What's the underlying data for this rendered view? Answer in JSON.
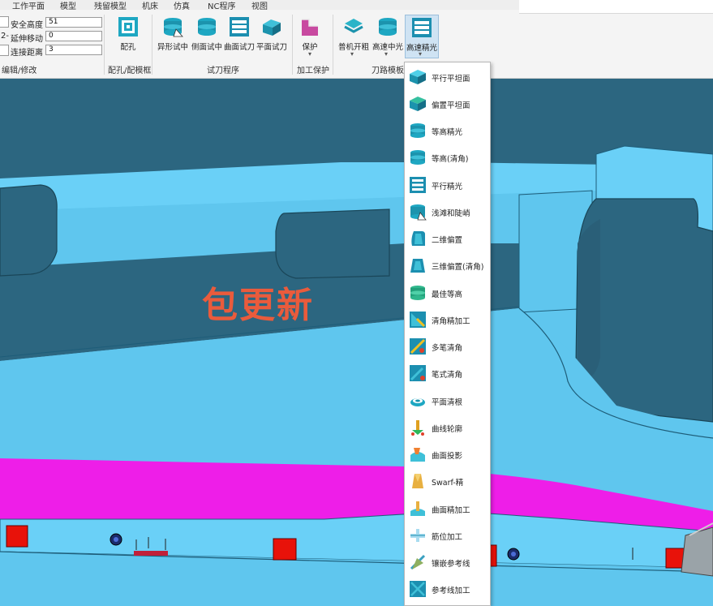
{
  "menu": [
    "工作平面",
    "模型",
    "残留模型",
    "机床",
    "仿真",
    "NC程序",
    "视图"
  ],
  "params": {
    "side_text": "2-",
    "safe_height_label": "安全高度",
    "safe_height_value": "51",
    "extend_move_label": "延伸移动",
    "extend_move_value": "0",
    "connect_dist_label": "连接距离",
    "connect_dist_value": "3"
  },
  "groups": {
    "edit": "编辑/修改",
    "hole": "配孔/配模框",
    "test": "试刀程序",
    "protect": "加工保护",
    "template": "刀路模板"
  },
  "buttons": {
    "hole": "配孔",
    "irregular": "异形试中",
    "side": "侧面试中",
    "surface": "曲面试刀",
    "plane": "平面试刀",
    "protect": "保护",
    "rough": "普机开粗",
    "hs_mid": "高速中光",
    "hs_finish": "高速精光",
    "dropdown_arrow": "▾"
  },
  "dropdown": [
    {
      "label": "平行平坦面",
      "icon": "parallel-flat-icon"
    },
    {
      "label": "偏置平坦面",
      "icon": "offset-flat-icon"
    },
    {
      "label": "等高精光",
      "icon": "constant-z-icon"
    },
    {
      "label": "等高(清角)",
      "icon": "constant-z-corner-icon"
    },
    {
      "label": "平行精光",
      "icon": "parallel-finish-icon"
    },
    {
      "label": "浅滩和陡峭",
      "icon": "shallow-steep-icon"
    },
    {
      "label": "二维偏置",
      "icon": "2d-offset-icon"
    },
    {
      "label": "三维偏置(清角)",
      "icon": "3d-offset-icon"
    },
    {
      "label": "最佳等高",
      "icon": "optimized-z-icon"
    },
    {
      "label": "清角精加工",
      "icon": "corner-finish-icon"
    },
    {
      "label": "多笔清角",
      "icon": "multi-pencil-icon"
    },
    {
      "label": "笔式清角",
      "icon": "pencil-corner-icon"
    },
    {
      "label": "平面清根",
      "icon": "flat-rest-icon"
    },
    {
      "label": "曲线轮廓",
      "icon": "curve-profile-icon"
    },
    {
      "label": "曲面投影",
      "icon": "surface-projection-icon"
    },
    {
      "label": "Swarf-精",
      "icon": "swarf-icon"
    },
    {
      "label": "曲面精加工",
      "icon": "surface-finish-icon"
    },
    {
      "label": "筋位加工",
      "icon": "rib-icon"
    },
    {
      "label": "镶嵌参考线",
      "icon": "embedded-ref-icon"
    },
    {
      "label": "参考线加工",
      "icon": "ref-line-icon"
    }
  ],
  "watermark": "包更新",
  "colors": {
    "viewport": "#5fc6ee",
    "model_dark": "#2c6680",
    "model_light": "#6ad0f7",
    "magenta": "#ee1ee8",
    "red_block": "#e8120a",
    "accent_cyan": "#1ec2d8"
  }
}
